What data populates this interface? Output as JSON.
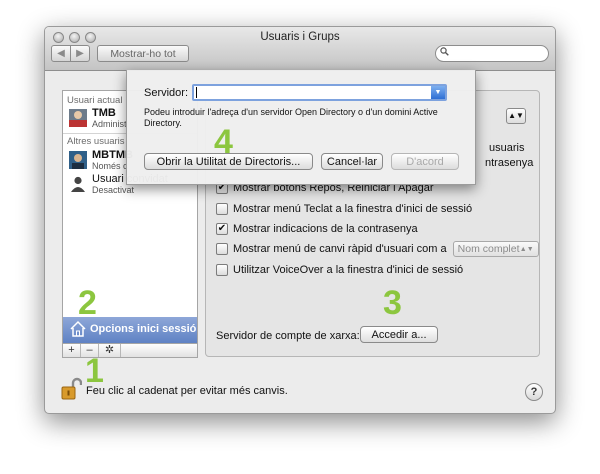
{
  "window": {
    "title": "Usuaris i Grups"
  },
  "toolbar": {
    "back": "◀",
    "forward": "▶",
    "show_all": "Mostrar-ho tot",
    "search_placeholder": ""
  },
  "sidebar": {
    "current_header": "Usuari actual",
    "current_user": {
      "name": "TMB",
      "role": "Administ"
    },
    "other_header": "Altres usuaris",
    "other_users": [
      {
        "name": "MBTMB",
        "role": "Només c"
      },
      {
        "name": "Usuari convidat",
        "role": "Desactivat"
      }
    ],
    "login_options": "Opcions inici sessió",
    "add": "+",
    "remove": "–",
    "gear": "✲"
  },
  "content": {
    "partial_right_1": "usuaris",
    "partial_right_2": "ntrasenya",
    "checkboxes": [
      {
        "label": "Mostrar botons Repòs, Reiniciar i Apagar",
        "checked": true
      },
      {
        "label": "Mostrar menú Teclat a la finestra d'inici de sessió",
        "checked": false
      },
      {
        "label": "Mostrar indicacions de la contrasenya",
        "checked": true
      },
      {
        "label": "Mostrar menú de canvi ràpid d'usuari com a",
        "checked": false
      },
      {
        "label": "Utilitzar VoiceOver a la finestra d'inici de sessió",
        "checked": false
      }
    ],
    "fast_switch_value": "Nom complet",
    "network_label": "Servidor de compte de xarxa:",
    "access_button": "Accedir a..."
  },
  "footer": {
    "lock_text": "Feu clic al cadenat per evitar més canvis.",
    "help": "?"
  },
  "sheet": {
    "server_label": "Servidor:",
    "server_value": "",
    "hint": "Podeu introduir l'adreça d'un servidor Open Directory o d'un domini Active Directory.",
    "open_utility": "Obrir la Utilitat de Directoris...",
    "cancel": "Cancel·lar",
    "ok": "D'acord"
  },
  "annotations": {
    "n1": "1",
    "n2": "2",
    "n3": "3",
    "n4": "4"
  },
  "colors": {
    "annotation": "#8cc63f",
    "selection": "#5f82c4"
  }
}
